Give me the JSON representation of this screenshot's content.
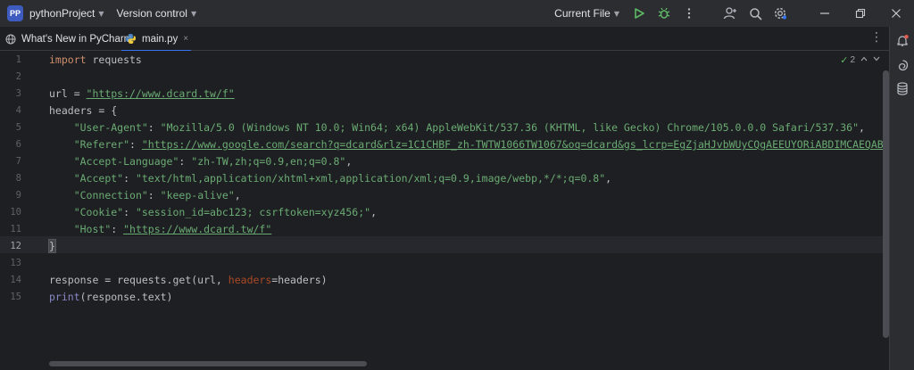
{
  "titlebar": {
    "project_badge": "PP",
    "project_name": "pythonProject",
    "vcs_label": "Version control",
    "run_config": "Current File",
    "icons": [
      "run-icon",
      "debug-icon",
      "more-vert-icon",
      "add-user-icon",
      "search-icon",
      "settings-icon",
      "minimize-icon",
      "restore-icon",
      "close-icon"
    ]
  },
  "tabs": [
    {
      "label": "What's New in PyCharm",
      "icon": "globe-icon",
      "active": false
    },
    {
      "label": "main.py",
      "icon": "python-file-icon",
      "active": true,
      "close": "×"
    }
  ],
  "editor": {
    "inspection_count": "2",
    "current_line": 12,
    "line_numbers": [
      "1",
      "2",
      "3",
      "4",
      "5",
      "6",
      "7",
      "8",
      "9",
      "10",
      "11",
      "12",
      "13",
      "14",
      "15"
    ],
    "code": {
      "l1_kw": "import",
      "l1_rest": " requests",
      "l3_var": "url = ",
      "l3_str": "\"https://www.dcard.tw/f\"",
      "l4": "headers = {",
      "l5_key": "\"User-Agent\"",
      "l5_val": "\"Mozilla/5.0 (Windows NT 10.0; Win64; x64) AppleWebKit/537.36 (KHTML, like Gecko) Chrome/105.0.0.0 Safari/537.36\"",
      "l6_key": "\"Referer\"",
      "l6_val": "\"https://www.google.com/search?q=dcard&rlz=1C1CHBF_zh-TWTW1066TW1067&oq=dcard&gs_lcrp=EgZjaHJvbWUyCQgAEEUYORiABDIMCAEQABhDGIA",
      "l7_key": "\"Accept-Language\"",
      "l7_val": "\"zh-TW,zh;q=0.9,en;q=0.8\"",
      "l8_key": "\"Accept\"",
      "l8_val": "\"text/html,application/xhtml+xml,application/xml;q=0.9,image/webp,*/*;q=0.8\"",
      "l9_key": "\"Connection\"",
      "l9_val": "\"keep-alive\"",
      "l10_key": "\"Cookie\"",
      "l10_val": "\"session_id=abc123; csrftoken=xyz456;\"",
      "l11_key": "\"Host\"",
      "l11_val": "\"https://www.dcard.tw/f\"",
      "l12": "}",
      "l14_a": "response = requests.get(url, ",
      "l14_param": "headers",
      "l14_b": "=headers)",
      "l15_fn": "print",
      "l15_rest": "(response.text)"
    }
  },
  "colors": {
    "keyword": "#cf8e6d",
    "string": "#6aab73",
    "builtin": "#8888c6",
    "param": "#aa4926",
    "accent": "#3574f0"
  }
}
